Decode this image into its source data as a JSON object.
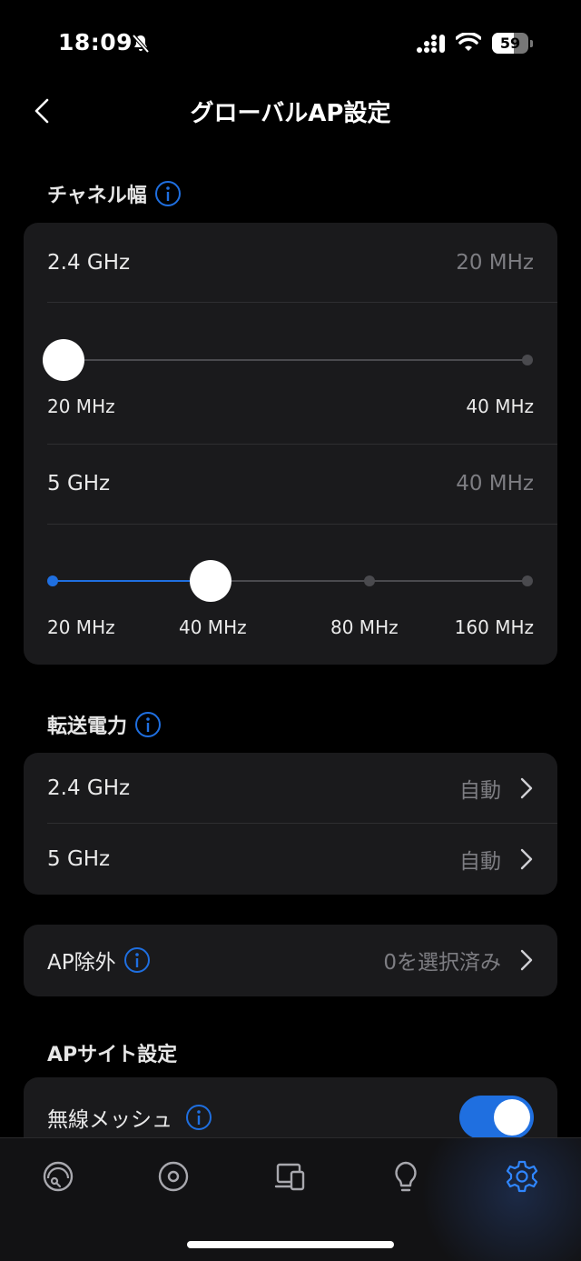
{
  "status_bar": {
    "time": "18:09",
    "battery": "59",
    "battery_level": 0.59,
    "icons": [
      "bell-muted-icon",
      "cellular-signal-icon",
      "wifi-icon",
      "battery-icon"
    ]
  },
  "header": {
    "title": "グローバルAP設定",
    "back_icon": "chevron-left-icon"
  },
  "channel_width": {
    "section_title": "チャネル幅",
    "band_24": {
      "label": "2.4 GHz",
      "value": "20 MHz",
      "options": [
        "20 MHz",
        "40 MHz"
      ],
      "selected_index": 0
    },
    "band_5": {
      "label": "5 GHz",
      "value": "40 MHz",
      "options": [
        "20 MHz",
        "40 MHz",
        "80 MHz",
        "160 MHz"
      ],
      "selected_index": 1
    }
  },
  "tx_power": {
    "section_title": "転送電力",
    "rows": [
      {
        "label": "2.4 GHz",
        "value": "自動"
      },
      {
        "label": "5 GHz",
        "value": "自動"
      }
    ]
  },
  "ap_exclusion": {
    "label": "AP除外",
    "value": "0を選択済み"
  },
  "ap_site": {
    "section_title": "APサイト設定",
    "wireless_mesh": {
      "label": "無線メッシュ",
      "enabled": true
    }
  },
  "tab_bar": {
    "tabs": [
      {
        "icon": "dashboard-icon",
        "active": false
      },
      {
        "icon": "target-icon",
        "active": false
      },
      {
        "icon": "devices-icon",
        "active": false
      },
      {
        "icon": "lightbulb-icon",
        "active": false
      },
      {
        "icon": "gear-icon",
        "active": true
      }
    ]
  },
  "colors": {
    "accent": "#1f6fe0",
    "background": "#000000",
    "card": "#1a1a1c",
    "muted_text": "#7d7d82"
  }
}
